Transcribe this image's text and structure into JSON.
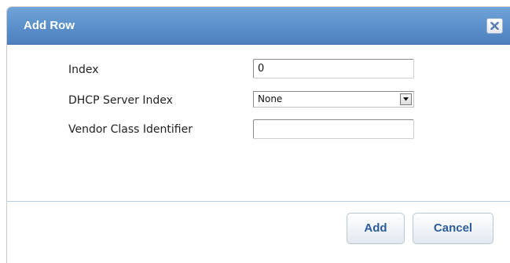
{
  "dialog": {
    "title": "Add Row",
    "close_icon": "close-icon"
  },
  "form": {
    "index": {
      "label": "Index",
      "value": "0"
    },
    "dhcp_server_index": {
      "label": "DHCP Server Index",
      "selected": "None",
      "options": [
        "None"
      ]
    },
    "vendor_class_identifier": {
      "label": "Vendor Class Identifier",
      "value": ""
    }
  },
  "buttons": {
    "add_label": "Add",
    "cancel_label": "Cancel"
  },
  "colors": {
    "title_bar": "#5b8fca",
    "button_text": "#2c5d99",
    "divider": "#b8cce0"
  }
}
